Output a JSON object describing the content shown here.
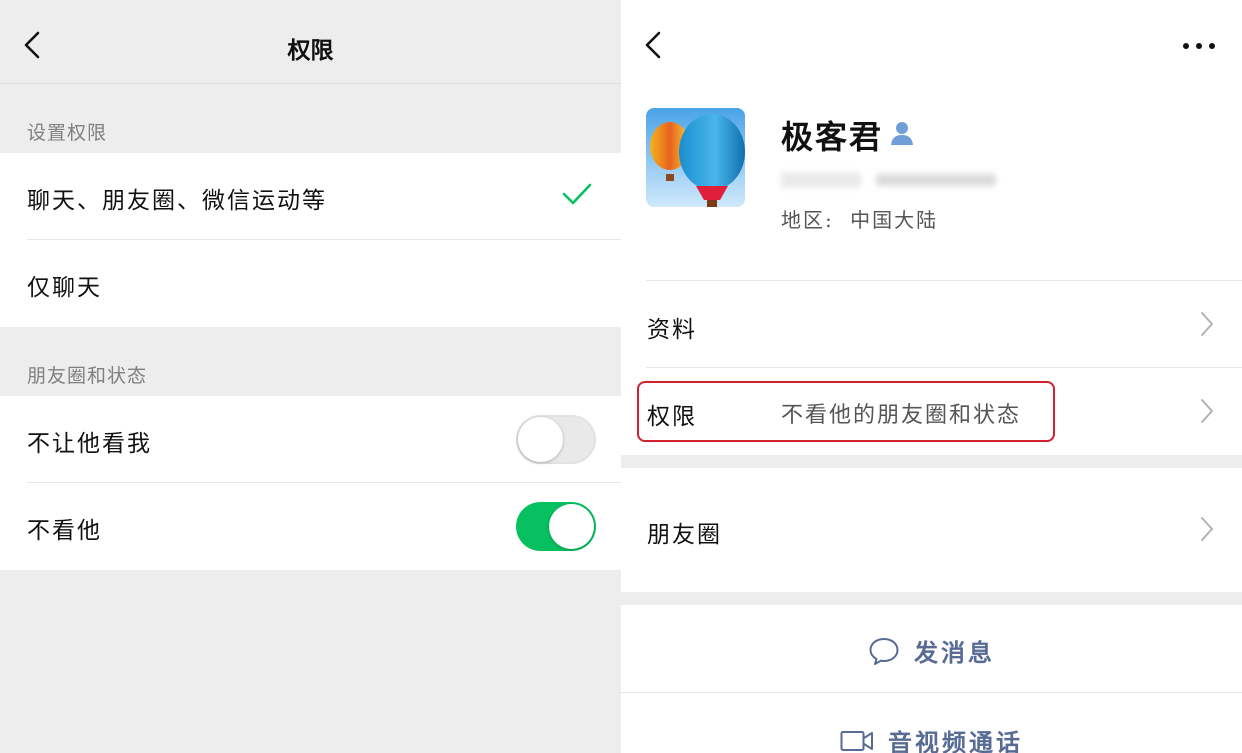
{
  "left": {
    "title": "权限",
    "section1_label": "设置权限",
    "section1_options": [
      {
        "label": "聊天、朋友圈、微信运动等",
        "selected": true
      },
      {
        "label": "仅聊天",
        "selected": false
      }
    ],
    "section2_label": "朋友圈和状态",
    "section2_toggles": [
      {
        "label": "不让他看我",
        "on": false
      },
      {
        "label": "不看他",
        "on": true
      }
    ]
  },
  "right": {
    "contact_name": "极客君",
    "region_label": "地区:",
    "region_value": "中国大陆",
    "rows": {
      "profile": "资料",
      "permission": "权限",
      "permission_value": "不看他的朋友圈和状态",
      "moments": "朋友圈"
    },
    "actions": {
      "message": "发消息",
      "call": "音视频通话"
    }
  },
  "colors": {
    "accent_green": "#07c160",
    "link_blue": "#576b95",
    "highlight_red": "#d2202f",
    "background_gray": "#ededed"
  },
  "icons": [
    "back-arrow-icon",
    "checkmark-icon",
    "person-icon",
    "more-icon",
    "chevron-right-icon",
    "chat-bubble-icon",
    "video-camera-icon"
  ]
}
